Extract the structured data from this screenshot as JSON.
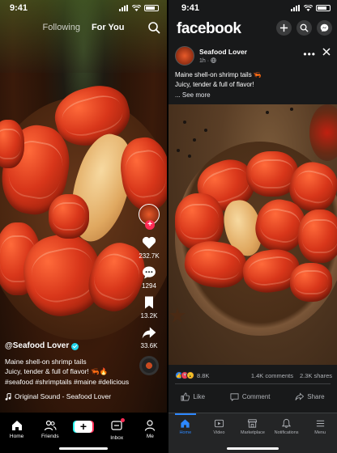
{
  "tiktok": {
    "status_time": "9:41",
    "tabs": [
      {
        "label": "Following",
        "active": false
      },
      {
        "label": "For You",
        "active": true
      }
    ],
    "username": "@Seafood Lover",
    "caption_lines": [
      "Maine shell-on shrimp tails",
      "Juicy, tender & full of flavor! 🦐🔥",
      "#seafood #shrimptails #maine #delicious"
    ],
    "sound": "Original Sound - Seafood Lover",
    "rail": {
      "likes": "232.7K",
      "comments": "1294",
      "saves": "13.2K",
      "shares": "33.6K"
    },
    "nav": [
      {
        "label": "Home",
        "icon": "home-icon"
      },
      {
        "label": "Friends",
        "icon": "friends-icon"
      },
      {
        "label": "",
        "icon": "create-icon"
      },
      {
        "label": "Inbox",
        "icon": "inbox-icon"
      },
      {
        "label": "Me",
        "icon": "profile-icon"
      }
    ],
    "create_symbol": "+",
    "accent": "#fe2c55"
  },
  "facebook": {
    "status_time": "9:41",
    "logo": "facebook",
    "page_name": "Seafood Lover",
    "post_time": "1h ·",
    "post_lines": [
      "Maine shell-on shrimp tails 🦐",
      "Juicy, tender & full of flavor!"
    ],
    "see_more": "... See more",
    "more_symbol": "•••",
    "reactions_count": "8.8K",
    "comments_count": "1.4K comments",
    "shares_count": "2.3K shares",
    "actions": [
      {
        "label": "Like",
        "icon": "thumbs-up-icon"
      },
      {
        "label": "Comment",
        "icon": "comment-icon"
      },
      {
        "label": "Share",
        "icon": "share-icon"
      }
    ],
    "nav": [
      {
        "label": "Home",
        "icon": "home-icon",
        "active": true
      },
      {
        "label": "Video",
        "icon": "video-icon",
        "active": false
      },
      {
        "label": "Marketplace",
        "icon": "marketplace-icon",
        "active": false
      },
      {
        "label": "Notifications",
        "icon": "bell-icon",
        "active": false
      },
      {
        "label": "Menu",
        "icon": "menu-icon",
        "active": false
      }
    ],
    "accent": "#2d88ff"
  }
}
